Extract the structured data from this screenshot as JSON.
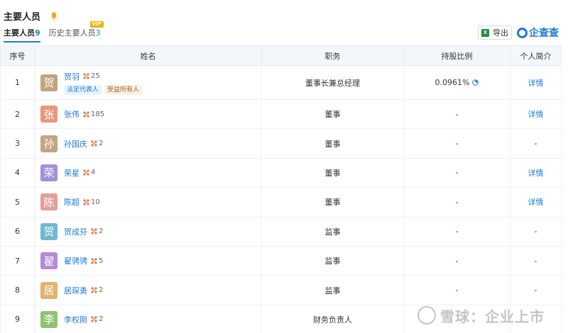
{
  "header": {
    "title": "主要人员",
    "export_label": "导出",
    "brand": "企查查"
  },
  "tabs": [
    {
      "label": "主要人员",
      "count": "9"
    },
    {
      "label": "历史主要人员",
      "count": "3",
      "badge": "VIP"
    }
  ],
  "columns": [
    "序号",
    "姓名",
    "职务",
    "持股比例",
    "个人简介"
  ],
  "rows": [
    {
      "index": "1",
      "avatar": "贺",
      "color": "#c2a47e",
      "name": "贺羽",
      "relations": "25",
      "position": "董事长兼总经理",
      "share": "0.0961%",
      "profile": "详情",
      "tags": [
        "法定代表人",
        "受益所有人"
      ]
    },
    {
      "index": "2",
      "avatar": "张",
      "color": "#e9967a",
      "name": "张伟",
      "relations": "185",
      "position": "董事",
      "share": "-",
      "profile": "详情"
    },
    {
      "index": "3",
      "avatar": "孙",
      "color": "#c4a47f",
      "name": "孙国庆",
      "relations": "2",
      "position": "董事",
      "share": "-",
      "profile": "-"
    },
    {
      "index": "4",
      "avatar": "荣",
      "color": "#a48fd9",
      "name": "荣星",
      "relations": "4",
      "position": "董事",
      "share": "-",
      "profile": "详情"
    },
    {
      "index": "5",
      "avatar": "陈",
      "color": "#e59c9c",
      "name": "陈超",
      "relations": "10",
      "position": "董事",
      "share": "-",
      "profile": "详情"
    },
    {
      "index": "6",
      "avatar": "贺",
      "color": "#6fb8d1",
      "name": "贺成芬",
      "relations": "2",
      "position": "监事",
      "share": "-",
      "profile": "-"
    },
    {
      "index": "7",
      "avatar": "翟",
      "color": "#b48ad9",
      "name": "翟骋骋",
      "relations": "5",
      "position": "监事",
      "share": "-",
      "profile": "-"
    },
    {
      "index": "8",
      "avatar": "居",
      "color": "#e3b26b",
      "name": "居琛勇",
      "relations": "2",
      "position": "监事",
      "share": "-",
      "profile": "-"
    },
    {
      "index": "9",
      "avatar": "李",
      "color": "#8fc46e",
      "name": "李权刚",
      "relations": "2",
      "position": "财务负责人",
      "share": "",
      "profile": ""
    }
  ],
  "watermark": "雪球：企业上市"
}
